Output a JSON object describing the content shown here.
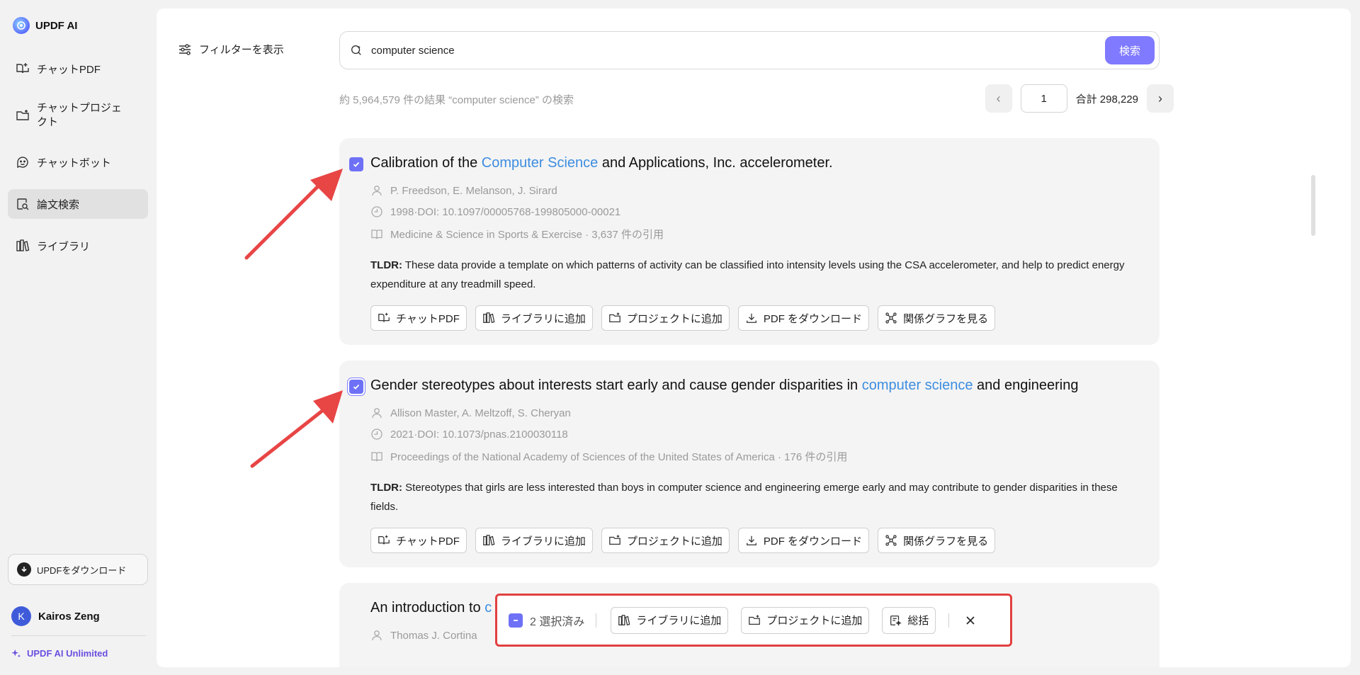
{
  "app": {
    "name": "UPDF AI"
  },
  "sidebar": {
    "items": [
      {
        "label": "チャットPDF",
        "icon": "book-chat-icon"
      },
      {
        "label": "チャットプロジェクト",
        "icon": "folder-chat-icon"
      },
      {
        "label": "チャットボット",
        "icon": "bot-icon"
      },
      {
        "label": "論文検索",
        "icon": "paper-search-icon",
        "active": true
      },
      {
        "label": "ライブラリ",
        "icon": "library-icon"
      }
    ],
    "download_label": "UPDFをダウンロード",
    "user": {
      "initial": "K",
      "name": "Kairos Zeng"
    },
    "plan_label": "UPDF AI Unlimited"
  },
  "filter": {
    "label": "フィルターを表示"
  },
  "search": {
    "value": "computer science",
    "button_label": "検索"
  },
  "results": {
    "info": "約 5,964,579 件の結果 “computer science” の検索"
  },
  "pager": {
    "prev": "‹",
    "page": "1",
    "total": "合計 298,229",
    "next": "›"
  },
  "papers": [
    {
      "title_pre": "Calibration of the ",
      "title_hl": "Computer Science",
      "title_post": " and Applications, Inc. accelerometer.",
      "authors": "P. Freedson,  E. Melanson,  J. Sirard",
      "date_doi": "1998·DOI: 10.1097/00005768-199805000-00021",
      "journal": "Medicine & Science in Sports & Exercise · 3,637 件の引用",
      "tldr_label": "TLDR:",
      "tldr": " These data provide a template on which patterns of activity can be classified into intensity levels using the CSA accelerometer, and help to predict energy expenditure at any treadmill speed."
    },
    {
      "title_pre": "Gender stereotypes about interests start early and cause gender disparities in ",
      "title_hl": "computer science",
      "title_post": " and engineering",
      "authors": "Allison Master,  A. Meltzoff,  S. Cheryan",
      "date_doi": "2021·DOI: 10.1073/pnas.2100030118",
      "journal": "Proceedings of the National Academy of Sciences of the United States of America · 176 件の引用",
      "tldr_label": "TLDR:",
      "tldr": " Stereotypes that girls are less interested than boys in computer science and engineering emerge early and may contribute to gender disparities in these fields."
    },
    {
      "title_pre": "An introduction to ",
      "title_hl": "c",
      "authors": "Thomas J. Cortina"
    }
  ],
  "actions": {
    "chat_pdf": "チャットPDF",
    "add_library": "ライブラリに追加",
    "add_project": "プロジェクトに追加",
    "download_pdf": "PDF をダウンロード",
    "view_graph": "関係グラフを見る"
  },
  "selection_bar": {
    "count_label": "2 選択済み",
    "add_library": "ライブラリに追加",
    "add_project": "プロジェクトに追加",
    "summarize": "総括"
  },
  "colors": {
    "accent": "#7f7aff",
    "highlight": "#3d8de0",
    "annotation": "#e24040"
  }
}
